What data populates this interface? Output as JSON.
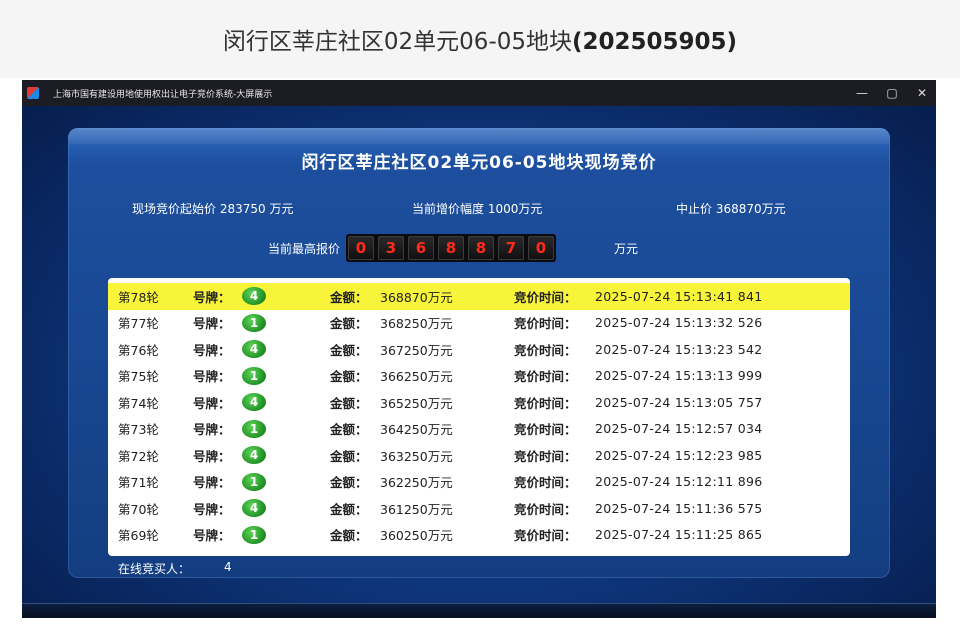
{
  "page_header": {
    "title_prefix": "闵行区莘庄社区02单元06-05地块",
    "title_code": "(202505905)"
  },
  "window": {
    "title": "上海市国有建设用地使用权出让电子竞价系统-大屏展示",
    "controls": {
      "minimize": "—",
      "maximize": "▢",
      "close": "✕"
    }
  },
  "panel": {
    "title": "闵行区莘庄社区02单元06-05地块现场竞价",
    "start_price": "现场竞价起始价 283750 万元",
    "increment": "当前增价幅度 1000万元",
    "cap_price": "中止价 368870万元",
    "highest_label": "当前最高报价",
    "highest_digits": [
      "0",
      "3",
      "6",
      "8",
      "8",
      "7",
      "0"
    ],
    "highest_unit": "万元"
  },
  "labels": {
    "paddle": "号牌：",
    "amount": "金额：",
    "time": "竞价时间："
  },
  "bids": [
    {
      "round": "第78轮",
      "paddle": "4",
      "amount": "368870万元",
      "time": "2025-07-24 15:13:41 841"
    },
    {
      "round": "第77轮",
      "paddle": "1",
      "amount": "368250万元",
      "time": "2025-07-24 15:13:32 526"
    },
    {
      "round": "第76轮",
      "paddle": "4",
      "amount": "367250万元",
      "time": "2025-07-24 15:13:23 542"
    },
    {
      "round": "第75轮",
      "paddle": "1",
      "amount": "366250万元",
      "time": "2025-07-24 15:13:13 999"
    },
    {
      "round": "第74轮",
      "paddle": "4",
      "amount": "365250万元",
      "time": "2025-07-24 15:13:05 757"
    },
    {
      "round": "第73轮",
      "paddle": "1",
      "amount": "364250万元",
      "time": "2025-07-24 15:12:57 034"
    },
    {
      "round": "第72轮",
      "paddle": "4",
      "amount": "363250万元",
      "time": "2025-07-24 15:12:23 985"
    },
    {
      "round": "第71轮",
      "paddle": "1",
      "amount": "362250万元",
      "time": "2025-07-24 15:12:11 896"
    },
    {
      "round": "第70轮",
      "paddle": "4",
      "amount": "361250万元",
      "time": "2025-07-24 15:11:36 575"
    },
    {
      "round": "第69轮",
      "paddle": "1",
      "amount": "360250万元",
      "time": "2025-07-24 15:11:25 865"
    }
  ],
  "online": {
    "label": "在线竞买人：",
    "count": "4"
  },
  "colors": {
    "highlight_row": "#f7f43a",
    "digit_red": "#ff2a1a",
    "badge_green": "#1e8f22"
  }
}
